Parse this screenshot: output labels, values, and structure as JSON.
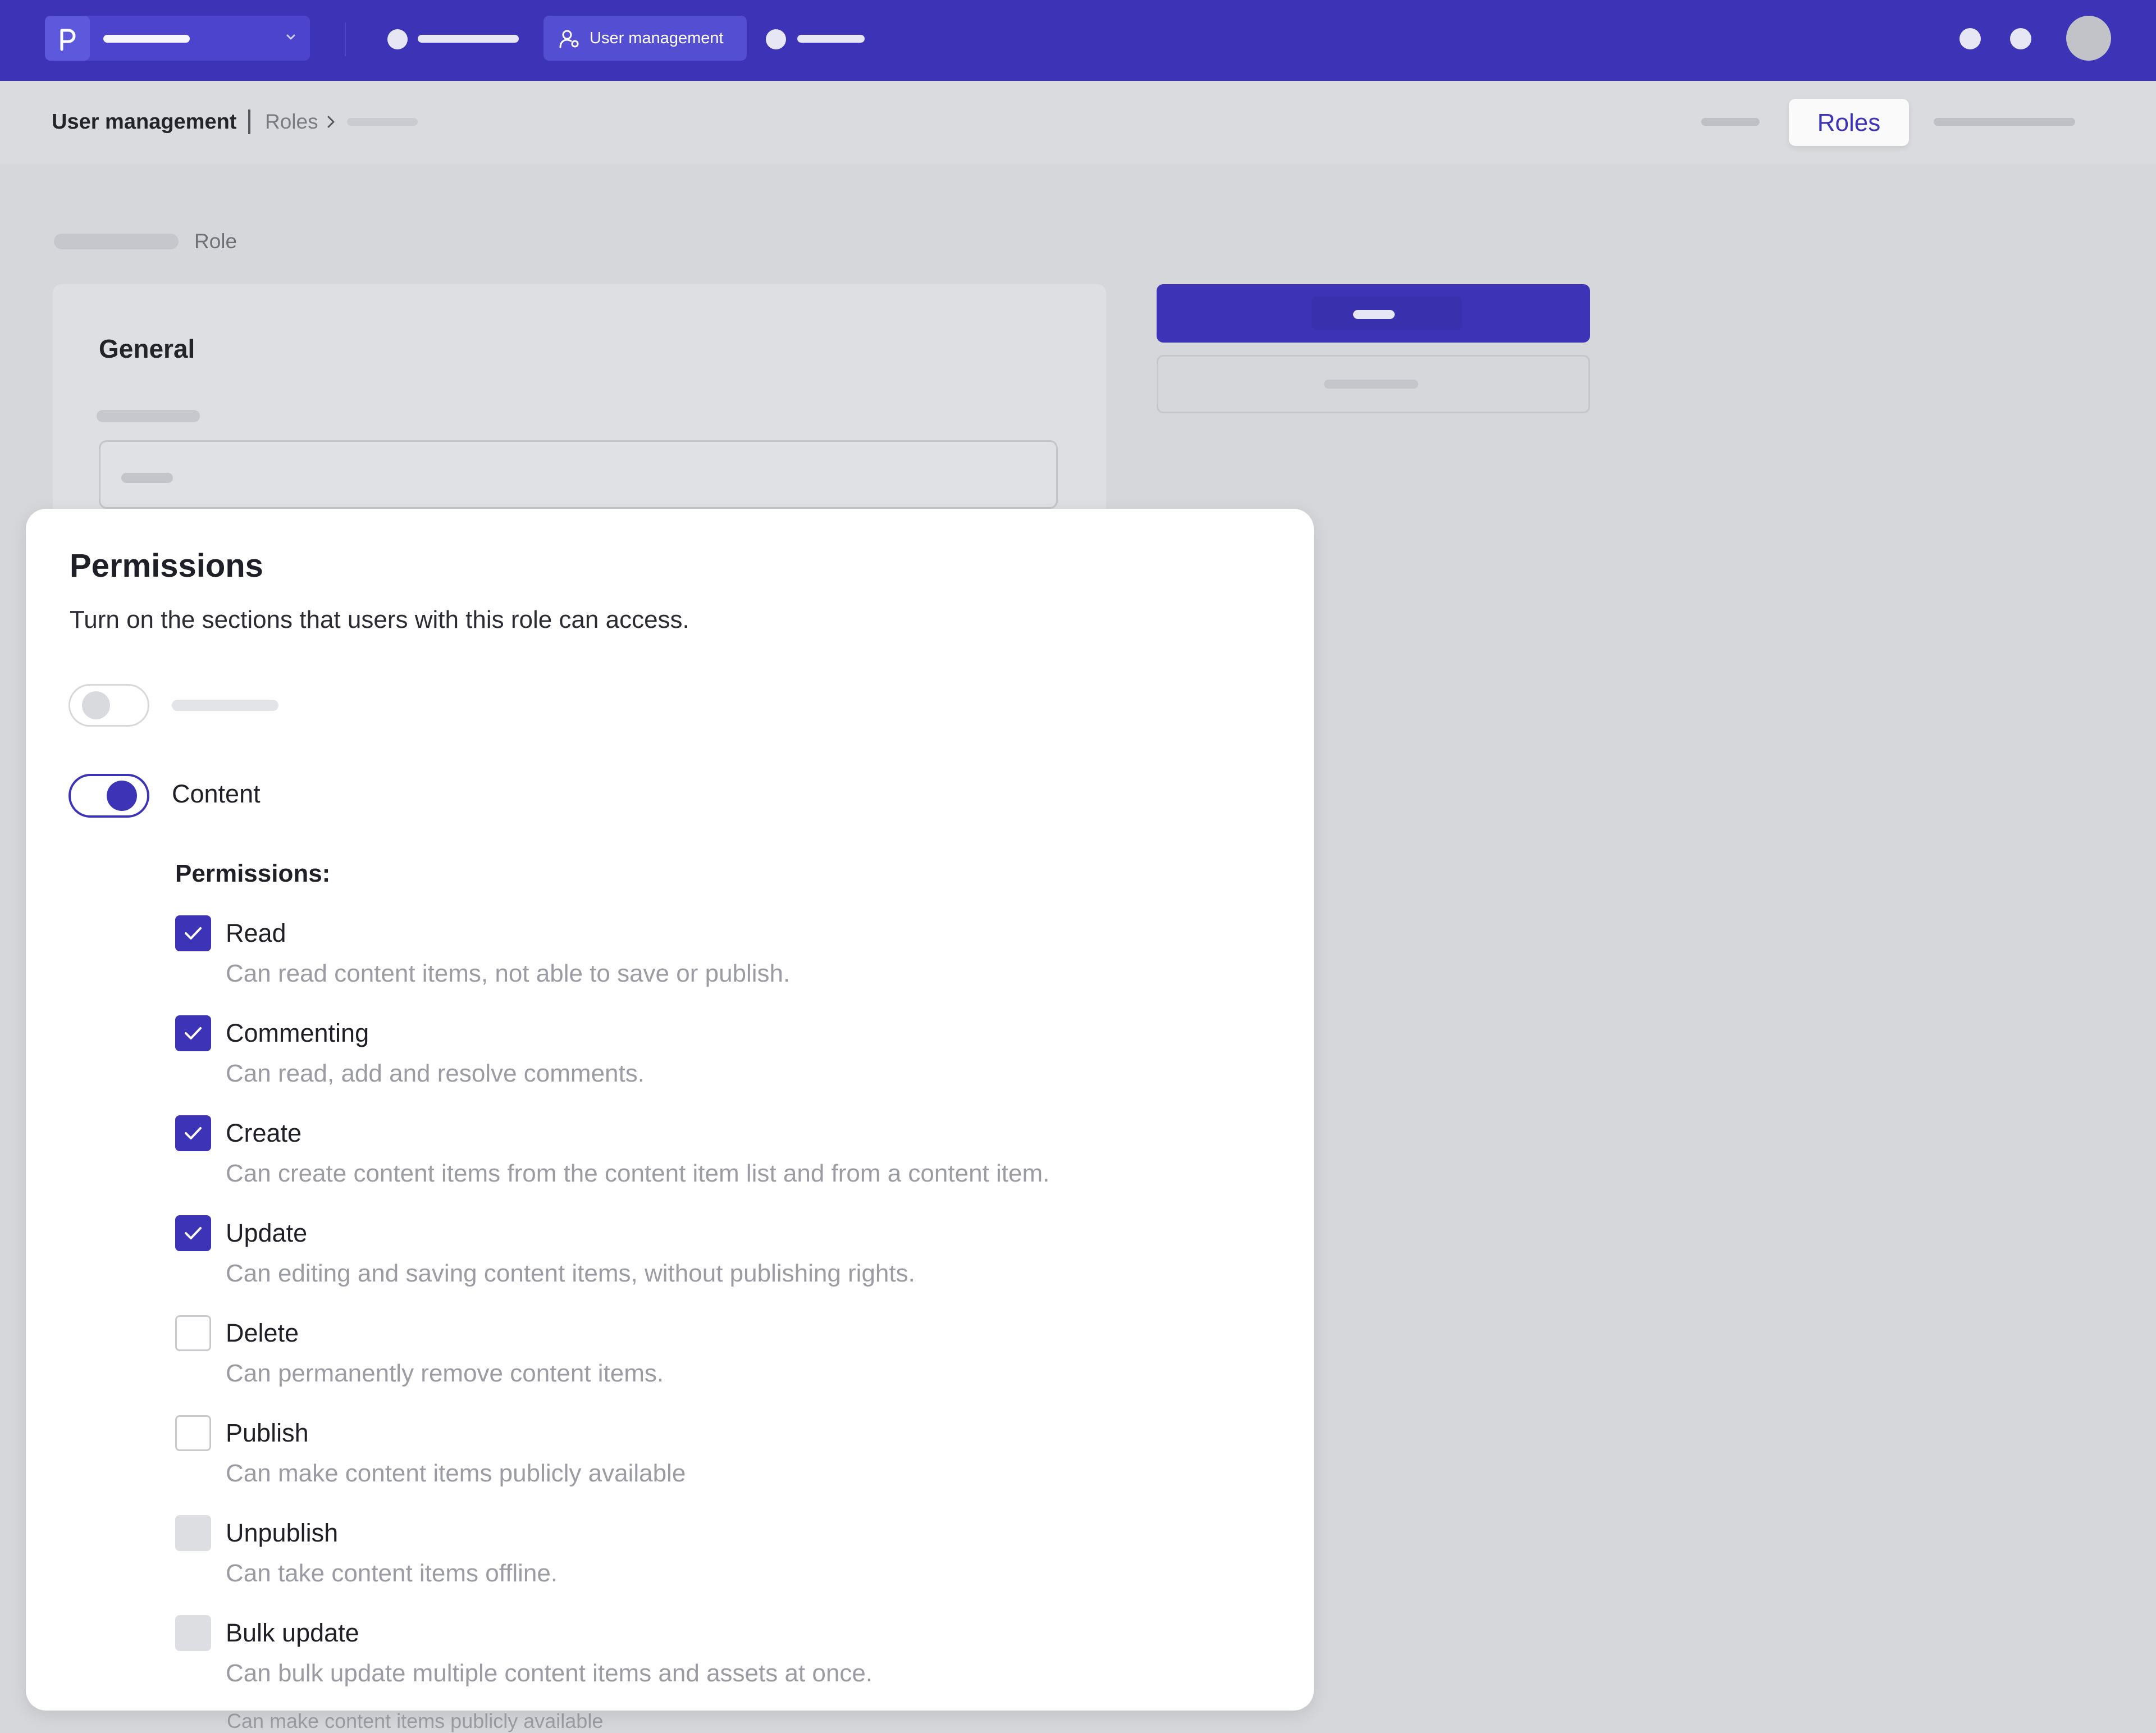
{
  "topnav": {
    "active_item_label": "User management"
  },
  "breadcrumb": {
    "section": "User management",
    "current": "Roles"
  },
  "subnav": {
    "active_tab": "Roles"
  },
  "page": {
    "heading_label": "Role",
    "general_card_title": "General"
  },
  "permissions_panel": {
    "title": "Permissions",
    "subtitle": "Turn on the sections that users with this role can access.",
    "sections": [
      {
        "label": "",
        "enabled": false
      },
      {
        "label": "Content",
        "enabled": true
      }
    ],
    "permissions_heading": "Permissions:",
    "items": [
      {
        "label": "Read",
        "description": "Can read content items, not able to save or publish.",
        "state": "checked"
      },
      {
        "label": "Commenting",
        "description": "Can read, add and resolve comments.",
        "state": "checked"
      },
      {
        "label": "Create",
        "description": "Can create content items from the content item list and from a content item.",
        "state": "checked"
      },
      {
        "label": "Update",
        "description": "Can editing and saving content items, without publishing rights.",
        "state": "checked"
      },
      {
        "label": "Delete",
        "description": "Can permanently remove content items.",
        "state": "unchecked"
      },
      {
        "label": "Publish",
        "description": "Can make content items publicly available",
        "state": "unchecked"
      },
      {
        "label": "Unpublish",
        "description": "Can take content items offline.",
        "state": "disabled"
      },
      {
        "label": "Bulk update",
        "description": "Can bulk update multiple content items and assets at once.",
        "state": "disabled"
      }
    ],
    "background_overflow_text": "Can make content items publicly available"
  },
  "colors": {
    "brand": "#3c33b6",
    "page_background": "#d6d7db",
    "panel_background": "#ffffff",
    "muted_text": "#9a9ba3"
  },
  "icons": {
    "logo": "p-logo-icon",
    "workspace_dropdown": "chevron-down-icon",
    "user_management": "user-settings-icon",
    "breadcrumb_separator": "chevron-right-icon",
    "checkbox_checked": "check-icon"
  }
}
